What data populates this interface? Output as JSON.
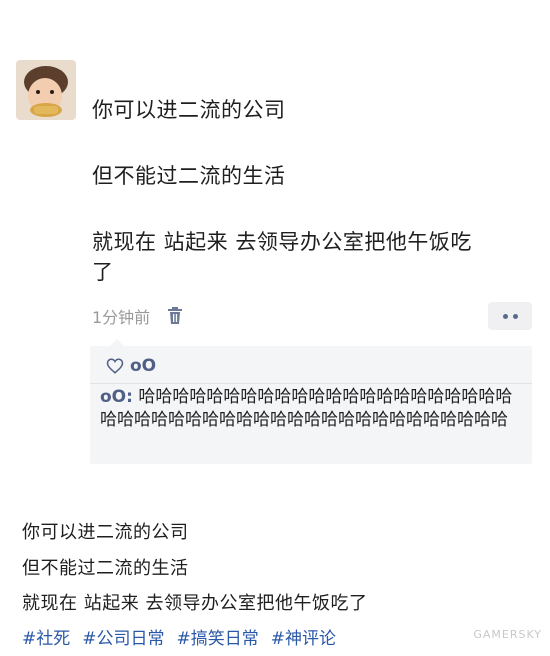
{
  "post": {
    "lines": [
      "你可以进二流的公司",
      "但不能过二流的生活",
      "就现在 站起来 去领导办公室把他午饭吃",
      "了"
    ],
    "time": "1分钟前"
  },
  "likes": {
    "name": "oO"
  },
  "comment": {
    "author": "oO:",
    "text": " 哈哈哈哈哈哈哈哈哈哈哈哈哈哈哈哈哈哈哈哈哈哈哈哈哈哈哈哈哈哈哈哈哈哈哈哈哈哈哈哈哈哈哈哈哈哈"
  },
  "caption": {
    "lines": [
      "你可以进二流的公司",
      "但不能过二流的生活",
      "就现在 站起来 去领导办公室把他午饭吃了"
    ]
  },
  "tags": [
    "#社死",
    "#公司日常",
    "#搞笑日常",
    "#神评论"
  ],
  "watermark": "GAMERSKY",
  "colors": {
    "link_blue": "#4f5f86",
    "tag_blue": "#2a58a8"
  }
}
